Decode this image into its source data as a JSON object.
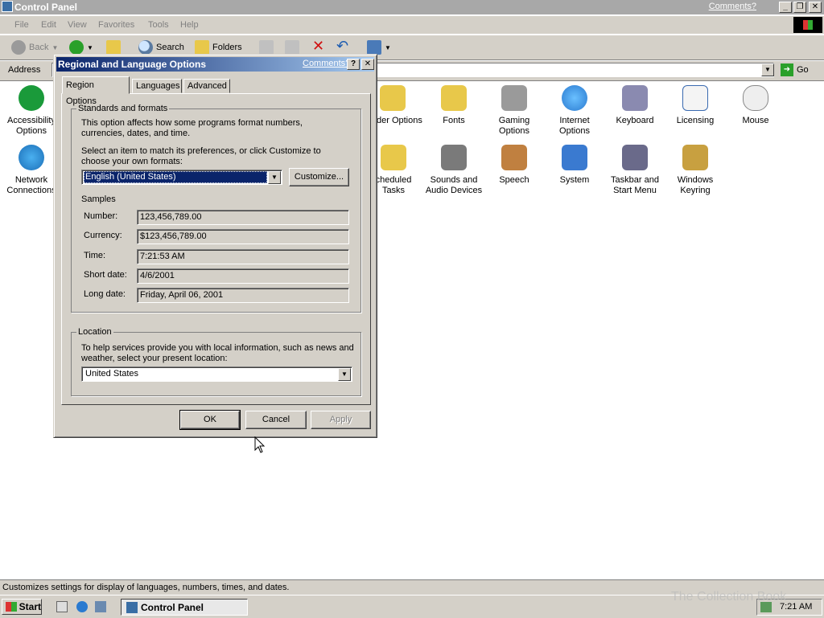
{
  "window": {
    "title": "Control Panel",
    "comments_link": "Comments?",
    "menu": [
      "File",
      "Edit",
      "View",
      "Favorites",
      "Tools",
      "Help"
    ],
    "toolbar": {
      "back": "Back",
      "search": "Search",
      "folders": "Folders"
    },
    "address_label": "Address",
    "go_label": "Go",
    "status_text": "Customizes settings for display of languages, numbers, times, and dates."
  },
  "control_panel_items": [
    {
      "label": "Accessibility Options",
      "icon": "accessibility-icon",
      "color": "#1a9a3a"
    },
    {
      "label": "Network Connections",
      "icon": "network-globe-icon",
      "color": "#1c6fb8"
    },
    {
      "label": "der Options",
      "icon": "folder-options-icon",
      "color": "#e8c84a"
    },
    {
      "label": "Fonts",
      "icon": "fonts-folder-icon",
      "color": "#e8c84a"
    },
    {
      "label": "Gaming Options",
      "icon": "joystick-icon",
      "color": "#9a9a9a"
    },
    {
      "label": "Internet Options",
      "icon": "internet-globe-icon",
      "color": "#2a7ad0"
    },
    {
      "label": "Keyboard",
      "icon": "keyboard-icon",
      "color": "#8a8ab0"
    },
    {
      "label": "Licensing",
      "icon": "certificate-icon",
      "color": "#3a6ab0"
    },
    {
      "label": "Mouse",
      "icon": "mouse-icon",
      "color": "#e0e0e0"
    },
    {
      "label": "cheduled Tasks",
      "icon": "scheduled-tasks-icon",
      "color": "#e8c84a"
    },
    {
      "label": "Sounds and Audio Devices",
      "icon": "speaker-icon",
      "color": "#7a7a7a"
    },
    {
      "label": "Speech",
      "icon": "speech-icon",
      "color": "#c08040"
    },
    {
      "label": "System",
      "icon": "system-icon",
      "color": "#3a7ad0"
    },
    {
      "label": "Taskbar and Start Menu",
      "icon": "taskbar-icon",
      "color": "#6a6a8a"
    },
    {
      "label": "Windows Keyring",
      "icon": "keys-icon",
      "color": "#c8a040"
    }
  ],
  "dialog": {
    "title": "Regional and Language Options",
    "comments_link": "Comments?",
    "tabs": [
      "Region Options",
      "Languages",
      "Advanced"
    ],
    "selected_tab": "Region Options",
    "standards_group": "Standards and formats",
    "standards_desc": "This option affects how some programs format numbers, currencies, dates, and time.",
    "select_prompt": "Select an item to match its preferences, or click Customize to choose your own formats:",
    "format_value": "English (United States)",
    "customize_button": "Customize...",
    "samples_label": "Samples",
    "samples": [
      {
        "label": "Number:",
        "value": "123,456,789.00"
      },
      {
        "label": "Currency:",
        "value": "$123,456,789.00"
      },
      {
        "label": "Time:",
        "value": "7:21:53 AM"
      },
      {
        "label": "Short date:",
        "value": "4/6/2001"
      },
      {
        "label": "Long date:",
        "value": "Friday, April 06, 2001"
      }
    ],
    "location_group": "Location",
    "location_desc": "To help services provide you with local information, such as news and weather, select your present location:",
    "location_value": "United States",
    "ok": "OK",
    "cancel": "Cancel",
    "apply": "Apply"
  },
  "taskbar": {
    "start": "Start",
    "task_button": "Control Panel",
    "clock": "7:21 AM"
  },
  "watermark": "The Collection Book"
}
